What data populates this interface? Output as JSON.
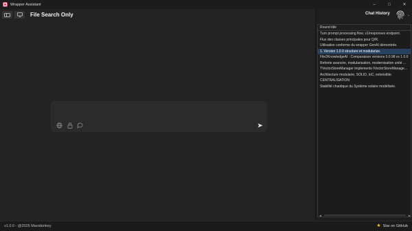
{
  "window": {
    "title": "Wrapper Assistant",
    "controls": [
      "–",
      "□",
      "✕"
    ]
  },
  "main": {
    "page_title": "File Search Only",
    "chat_input": {
      "value": "",
      "placeholder": ""
    }
  },
  "sidebar": {
    "title": "Chat History",
    "column_header": "Round title",
    "rows": [
      "Turn prompt processing flow, v1/responses endpoint.",
      "Flux des classes principales pour Q/R.",
      "Utilisation conforme du wrapper GenAI démontrée.",
      "1. Version 1.0.0 structure et modularize.",
      "File2KnowledgeAI : Comparaison versions 0.0.98 vs 1.0.0",
      "Refonte avancée, modularisation, modernisation unité ...",
      "TVectorStoreManager implements IVectorStoreManage...",
      "Architecture modulaire, SOLID, IoC, extensible.",
      "CENTRALISATION",
      "Stabilité chaotique du Système solaire modélisée."
    ],
    "selected_index": 3
  },
  "status": {
    "version": "v1.0.0 - @2025 Maxidonkey",
    "github_label": "Star on GitHub"
  }
}
